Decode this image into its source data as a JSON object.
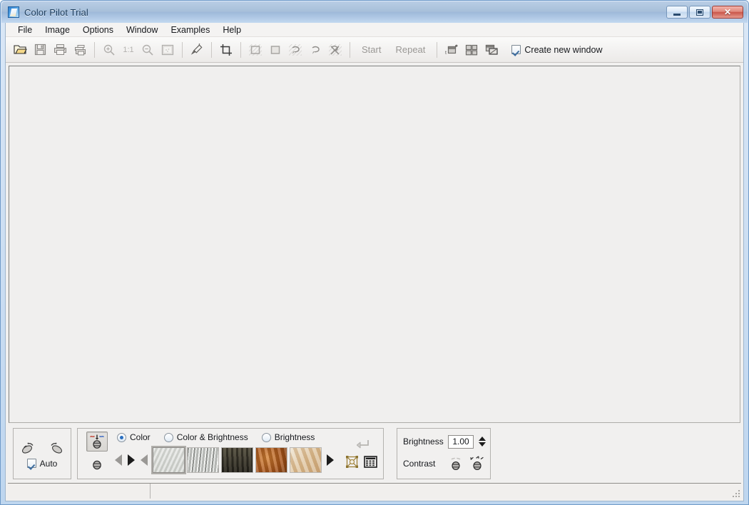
{
  "window": {
    "title": "Color Pilot Trial",
    "icon": "app-icon",
    "buttons": {
      "minimize": "minimize-button",
      "maximize": "maximize-button",
      "close_glyph": "✕"
    }
  },
  "menubar": {
    "items": [
      {
        "label": "File"
      },
      {
        "label": "Image"
      },
      {
        "label": "Options"
      },
      {
        "label": "Window"
      },
      {
        "label": "Examples"
      },
      {
        "label": "Help"
      }
    ]
  },
  "toolbar": {
    "buttons": [
      {
        "name": "open-icon",
        "tip": "Open"
      },
      {
        "name": "save-icon",
        "tip": "Save"
      },
      {
        "name": "print-icon",
        "tip": "Print"
      },
      {
        "name": "print-preview-icon",
        "tip": "Print preview"
      },
      {
        "name": "zoom-in-icon",
        "tip": "Zoom in"
      },
      {
        "name": "zoom-out-icon",
        "tip": "Zoom out"
      },
      {
        "name": "fit-window-icon",
        "tip": "Fit to window"
      },
      {
        "name": "eyedropper-icon",
        "tip": "Pick color"
      },
      {
        "name": "crop-icon",
        "tip": "Crop"
      },
      {
        "name": "select-rect-icon",
        "tip": "Rectangular selection"
      },
      {
        "name": "select-rect-filled-icon",
        "tip": "Filled rectangular selection"
      },
      {
        "name": "lasso-icon",
        "tip": "Lasso"
      },
      {
        "name": "lasso-open-icon",
        "tip": "Free lasso"
      },
      {
        "name": "deselect-icon",
        "tip": "Deselect"
      },
      {
        "name": "new-window-icon",
        "tip": "New window"
      },
      {
        "name": "tile-icon",
        "tip": "Tile windows"
      },
      {
        "name": "cascade-icon",
        "tip": "Cascade windows"
      }
    ],
    "zoom_ratio": "1:1",
    "start_label": "Start",
    "repeat_label": "Repeat",
    "create_new_window": {
      "label": "Create new window",
      "checked": true
    }
  },
  "panels": {
    "rotate": {
      "rotate_left": "rotate-left-icon",
      "rotate_right": "rotate-right-icon",
      "auto_label": "Auto",
      "auto_checked": true
    },
    "texture": {
      "mode_buttons": [
        {
          "name": "apply-color-icon",
          "pressed": true
        },
        {
          "name": "sample-color-icon",
          "pressed": false
        }
      ],
      "modes": [
        {
          "label": "Color",
          "selected": true
        },
        {
          "label": "Color & Brightness",
          "selected": false
        },
        {
          "label": "Brightness",
          "selected": false
        }
      ],
      "thumbnails": [
        {
          "name": "thumb-gray-stone",
          "class": "t1",
          "selected": true
        },
        {
          "name": "thumb-white-wood",
          "class": "t2",
          "selected": false
        },
        {
          "name": "thumb-dark-wood",
          "class": "t3",
          "selected": false
        },
        {
          "name": "thumb-orange-rust",
          "class": "t4",
          "selected": false
        },
        {
          "name": "thumb-beige-marble",
          "class": "t5",
          "selected": false
        }
      ],
      "nav": {
        "prev_page": "prev-page-arrow",
        "prev": "prev-arrow",
        "next": "next-arrow"
      },
      "tail": {
        "apply_return": "return-arrow-icon",
        "transform": "transform-icon",
        "list_view": "list-view-icon"
      }
    },
    "adjust": {
      "brightness_label": "Brightness",
      "brightness_value": "1.00",
      "contrast_label": "Contrast",
      "contrast_buttons": [
        {
          "name": "contrast-decrease-icon"
        },
        {
          "name": "contrast-increase-icon"
        }
      ]
    }
  },
  "statusbar": {
    "left": "",
    "right": ""
  },
  "colors": {
    "title_gradient_top": "#b9cde5",
    "title_gradient_bottom": "#c2d8f0",
    "window_border": "#6f9ac8",
    "canvas": "#f0efee",
    "panel_bg": "#f1f0ef",
    "accent_radio": "#2b6fc0",
    "disabled_text": "#9a9895"
  }
}
